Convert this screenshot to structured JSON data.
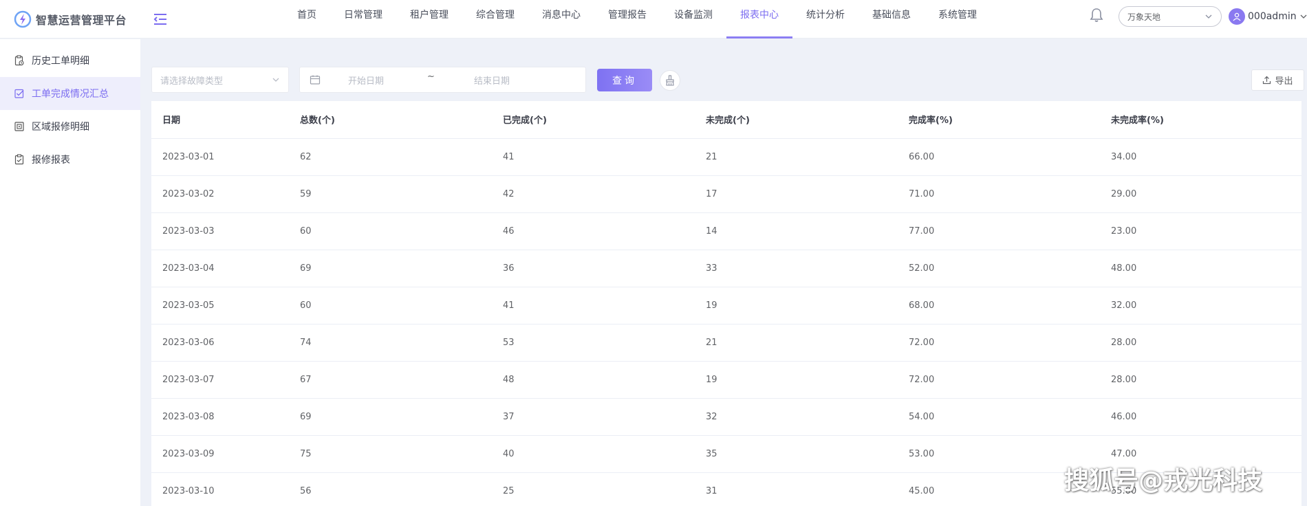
{
  "app": {
    "title": "智慧运营管理平台"
  },
  "nav": {
    "items": [
      {
        "label": "首页",
        "active": false
      },
      {
        "label": "日常管理",
        "active": false
      },
      {
        "label": "租户管理",
        "active": false
      },
      {
        "label": "综合管理",
        "active": false
      },
      {
        "label": "消息中心",
        "active": false
      },
      {
        "label": "管理报告",
        "active": false
      },
      {
        "label": "设备监测",
        "active": false
      },
      {
        "label": "报表中心",
        "active": true
      },
      {
        "label": "统计分析",
        "active": false
      },
      {
        "label": "基础信息",
        "active": false
      },
      {
        "label": "系统管理",
        "active": false
      }
    ]
  },
  "header": {
    "site": "万象天地",
    "user": "000admin"
  },
  "sidebar": {
    "items": [
      {
        "label": "历史工单明细",
        "icon": "clipboard-clock-icon",
        "active": false
      },
      {
        "label": "工单完成情况汇总",
        "icon": "checkbox-icon",
        "active": true
      },
      {
        "label": "区域报修明细",
        "icon": "region-icon",
        "active": false
      },
      {
        "label": "报修报表",
        "icon": "clipboard-check-icon",
        "active": false
      }
    ]
  },
  "filters": {
    "fault_type_placeholder": "请选择故障类型",
    "start_placeholder": "开始日期",
    "separator": "~",
    "end_placeholder": "结束日期",
    "query_label": "查询",
    "export_label": "导出"
  },
  "table": {
    "columns": [
      "日期",
      "总数(个)",
      "已完成(个)",
      "未完成(个)",
      "完成率(%)",
      "未完成率(%)"
    ],
    "rows": [
      [
        "2023-03-01",
        "62",
        "41",
        "21",
        "66.00",
        "34.00"
      ],
      [
        "2023-03-02",
        "59",
        "42",
        "17",
        "71.00",
        "29.00"
      ],
      [
        "2023-03-03",
        "60",
        "46",
        "14",
        "77.00",
        "23.00"
      ],
      [
        "2023-03-04",
        "69",
        "36",
        "33",
        "52.00",
        "48.00"
      ],
      [
        "2023-03-05",
        "60",
        "41",
        "19",
        "68.00",
        "32.00"
      ],
      [
        "2023-03-06",
        "74",
        "53",
        "21",
        "72.00",
        "28.00"
      ],
      [
        "2023-03-07",
        "67",
        "48",
        "19",
        "72.00",
        "28.00"
      ],
      [
        "2023-03-08",
        "69",
        "37",
        "32",
        "54.00",
        "46.00"
      ],
      [
        "2023-03-09",
        "75",
        "40",
        "35",
        "53.00",
        "47.00"
      ],
      [
        "2023-03-10",
        "56",
        "25",
        "31",
        "45.00",
        "55.00"
      ]
    ]
  },
  "watermark": "搜狐号@戎光科技",
  "colors": {
    "accent": "#7b6cf0",
    "page_bg": "#eef1f8"
  }
}
